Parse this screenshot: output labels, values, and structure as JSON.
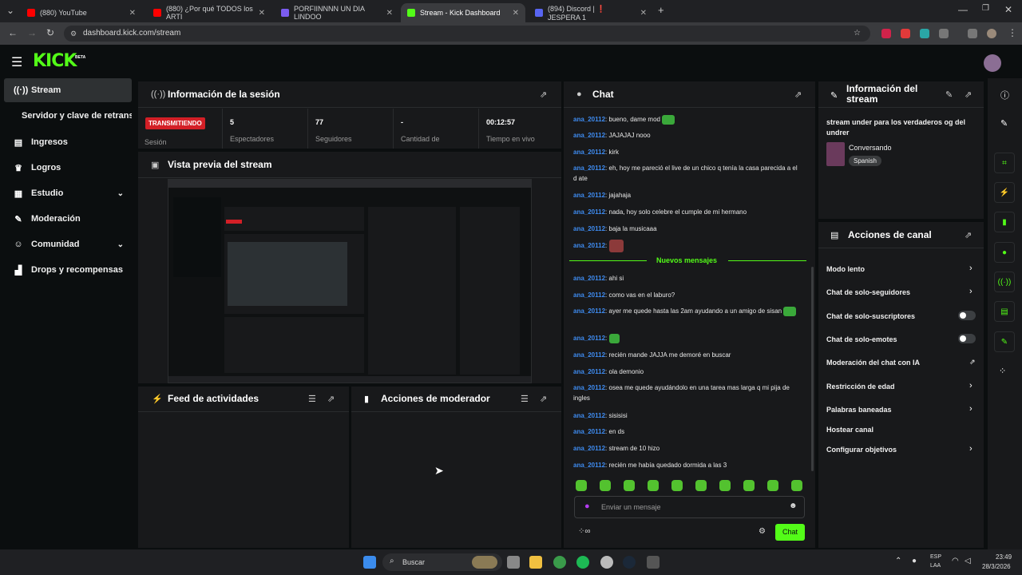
{
  "browser": {
    "tabs": [
      {
        "label": "(880) YouTube",
        "color": "#ff0000"
      },
      {
        "label": "(880) ¿Por qué TODOS los ARTI",
        "color": "#ff0000"
      },
      {
        "label": "PORFIINNNN UN DIA LINDOO",
        "color": "#7b5cf0"
      },
      {
        "label": "Stream - Kick Dashboard",
        "color": "#53fc18"
      },
      {
        "label": "(894) Discord | ❗ JESPERA 1",
        "color": "#5865f2"
      }
    ],
    "url": "dashboard.kick.com/stream"
  },
  "header": {
    "logo": "KICK",
    "beta": "BETA"
  },
  "sidebar": {
    "items": [
      {
        "label": "Stream",
        "icon": "broadcast-icon"
      },
      {
        "label": "Servidor y clave de retransn",
        "icon": ""
      },
      {
        "label": "Ingresos",
        "icon": "revenue-icon"
      },
      {
        "label": "Logros",
        "icon": "trophy-icon"
      },
      {
        "label": "Estudio",
        "icon": "studio-icon"
      },
      {
        "label": "Moderación",
        "icon": "wrench-icon"
      },
      {
        "label": "Comunidad",
        "icon": "community-icon"
      },
      {
        "label": "Drops y recompensas",
        "icon": "drops-icon"
      }
    ]
  },
  "session": {
    "title": "Información de la sesión",
    "status": "TRANSMITIENDO",
    "status_label": "Sesión",
    "stats": [
      {
        "value": "5",
        "label": "Espectadores"
      },
      {
        "value": "77",
        "label": "Seguidores"
      },
      {
        "value": "-",
        "label": "Cantidad de"
      },
      {
        "value": "00:12:57",
        "label": "Tiempo en vivo"
      }
    ]
  },
  "preview": {
    "title": "Vista previa del stream"
  },
  "activity": {
    "title": "Feed de actividades"
  },
  "modactions": {
    "title": "Acciones de moderador"
  },
  "chat": {
    "title": "Chat",
    "messages": [
      {
        "user": "ana_20112",
        "text": "bueno, dame mod",
        "emote": true
      },
      {
        "user": "ana_20112",
        "text": "JAJAJAJ nooo"
      },
      {
        "user": "ana_20112",
        "text": "kirk"
      },
      {
        "user": "ana_20112",
        "text": "eh, hoy me pareció el live de un chico q tenía la casa parecida a el d ate"
      },
      {
        "user": "ana_20112",
        "text": "jajahaja"
      },
      {
        "user": "ana_20112",
        "text": "nada, hoy solo celebre el cumple de mi hermano"
      },
      {
        "user": "ana_20112",
        "text": "baja la musicaaa"
      },
      {
        "user": "ana_20112",
        "text": "",
        "emote": true
      }
    ],
    "new_messages": "Nuevos mensajes",
    "messages_new": [
      {
        "user": "ana_20112",
        "text": "ahi si"
      },
      {
        "user": "ana_20112",
        "text": "como vas en el laburo?"
      },
      {
        "user": "ana_20112",
        "text": "ayer me quede hasta las 2am ayudando a un amigo de sisan",
        "emote": true
      },
      {
        "user": "ana_20112",
        "text": "",
        "emote": true
      },
      {
        "user": "ana_20112",
        "text": "recién mande JAJJA me demoré en buscar"
      },
      {
        "user": "ana_20112",
        "text": "ola demonio"
      },
      {
        "user": "ana_20112",
        "text": "osea me quede ayudándolo en una tarea mas larga q mi pija de ingles"
      },
      {
        "user": "ana_20112",
        "text": "sisisisi"
      },
      {
        "user": "ana_20112",
        "text": "en ds"
      },
      {
        "user": "ana_20112",
        "text": "stream de 10 hizo"
      },
      {
        "user": "ana_20112",
        "text": "recién me había quedado dormida a las 3"
      }
    ],
    "input_placeholder": "Enviar un mensaje",
    "send_label": "Chat"
  },
  "stream_info": {
    "title": "Información del stream",
    "stream_title": "stream under para los verdaderos og del undrer",
    "category": "Conversando",
    "language": "Spanish"
  },
  "channel_actions": {
    "title": "Acciones de canal",
    "items": [
      {
        "label": "Modo lento",
        "control": "chevron"
      },
      {
        "label": "Chat de solo-seguidores",
        "control": "chevron"
      },
      {
        "label": "Chat de solo-suscriptores",
        "control": "toggle"
      },
      {
        "label": "Chat de solo-emotes",
        "control": "toggle"
      },
      {
        "label": "Moderación del chat con IA",
        "control": "external"
      },
      {
        "label": "Restricción de edad",
        "control": "chevron"
      },
      {
        "label": "Palabras baneadas",
        "control": "chevron"
      },
      {
        "label": "Hostear canal",
        "control": "none"
      },
      {
        "label": "Configurar objetivos",
        "control": "chevron"
      }
    ]
  },
  "taskbar": {
    "search": "Buscar",
    "lang": "ESP",
    "lang2": "LAA",
    "time": "23:49",
    "date": "28/3/2026"
  },
  "colors": {
    "accent": "#53fc18",
    "live": "#d31f26",
    "username": "#3e8bf0",
    "panel": "#18191b",
    "bg": "#0b0e0f"
  }
}
